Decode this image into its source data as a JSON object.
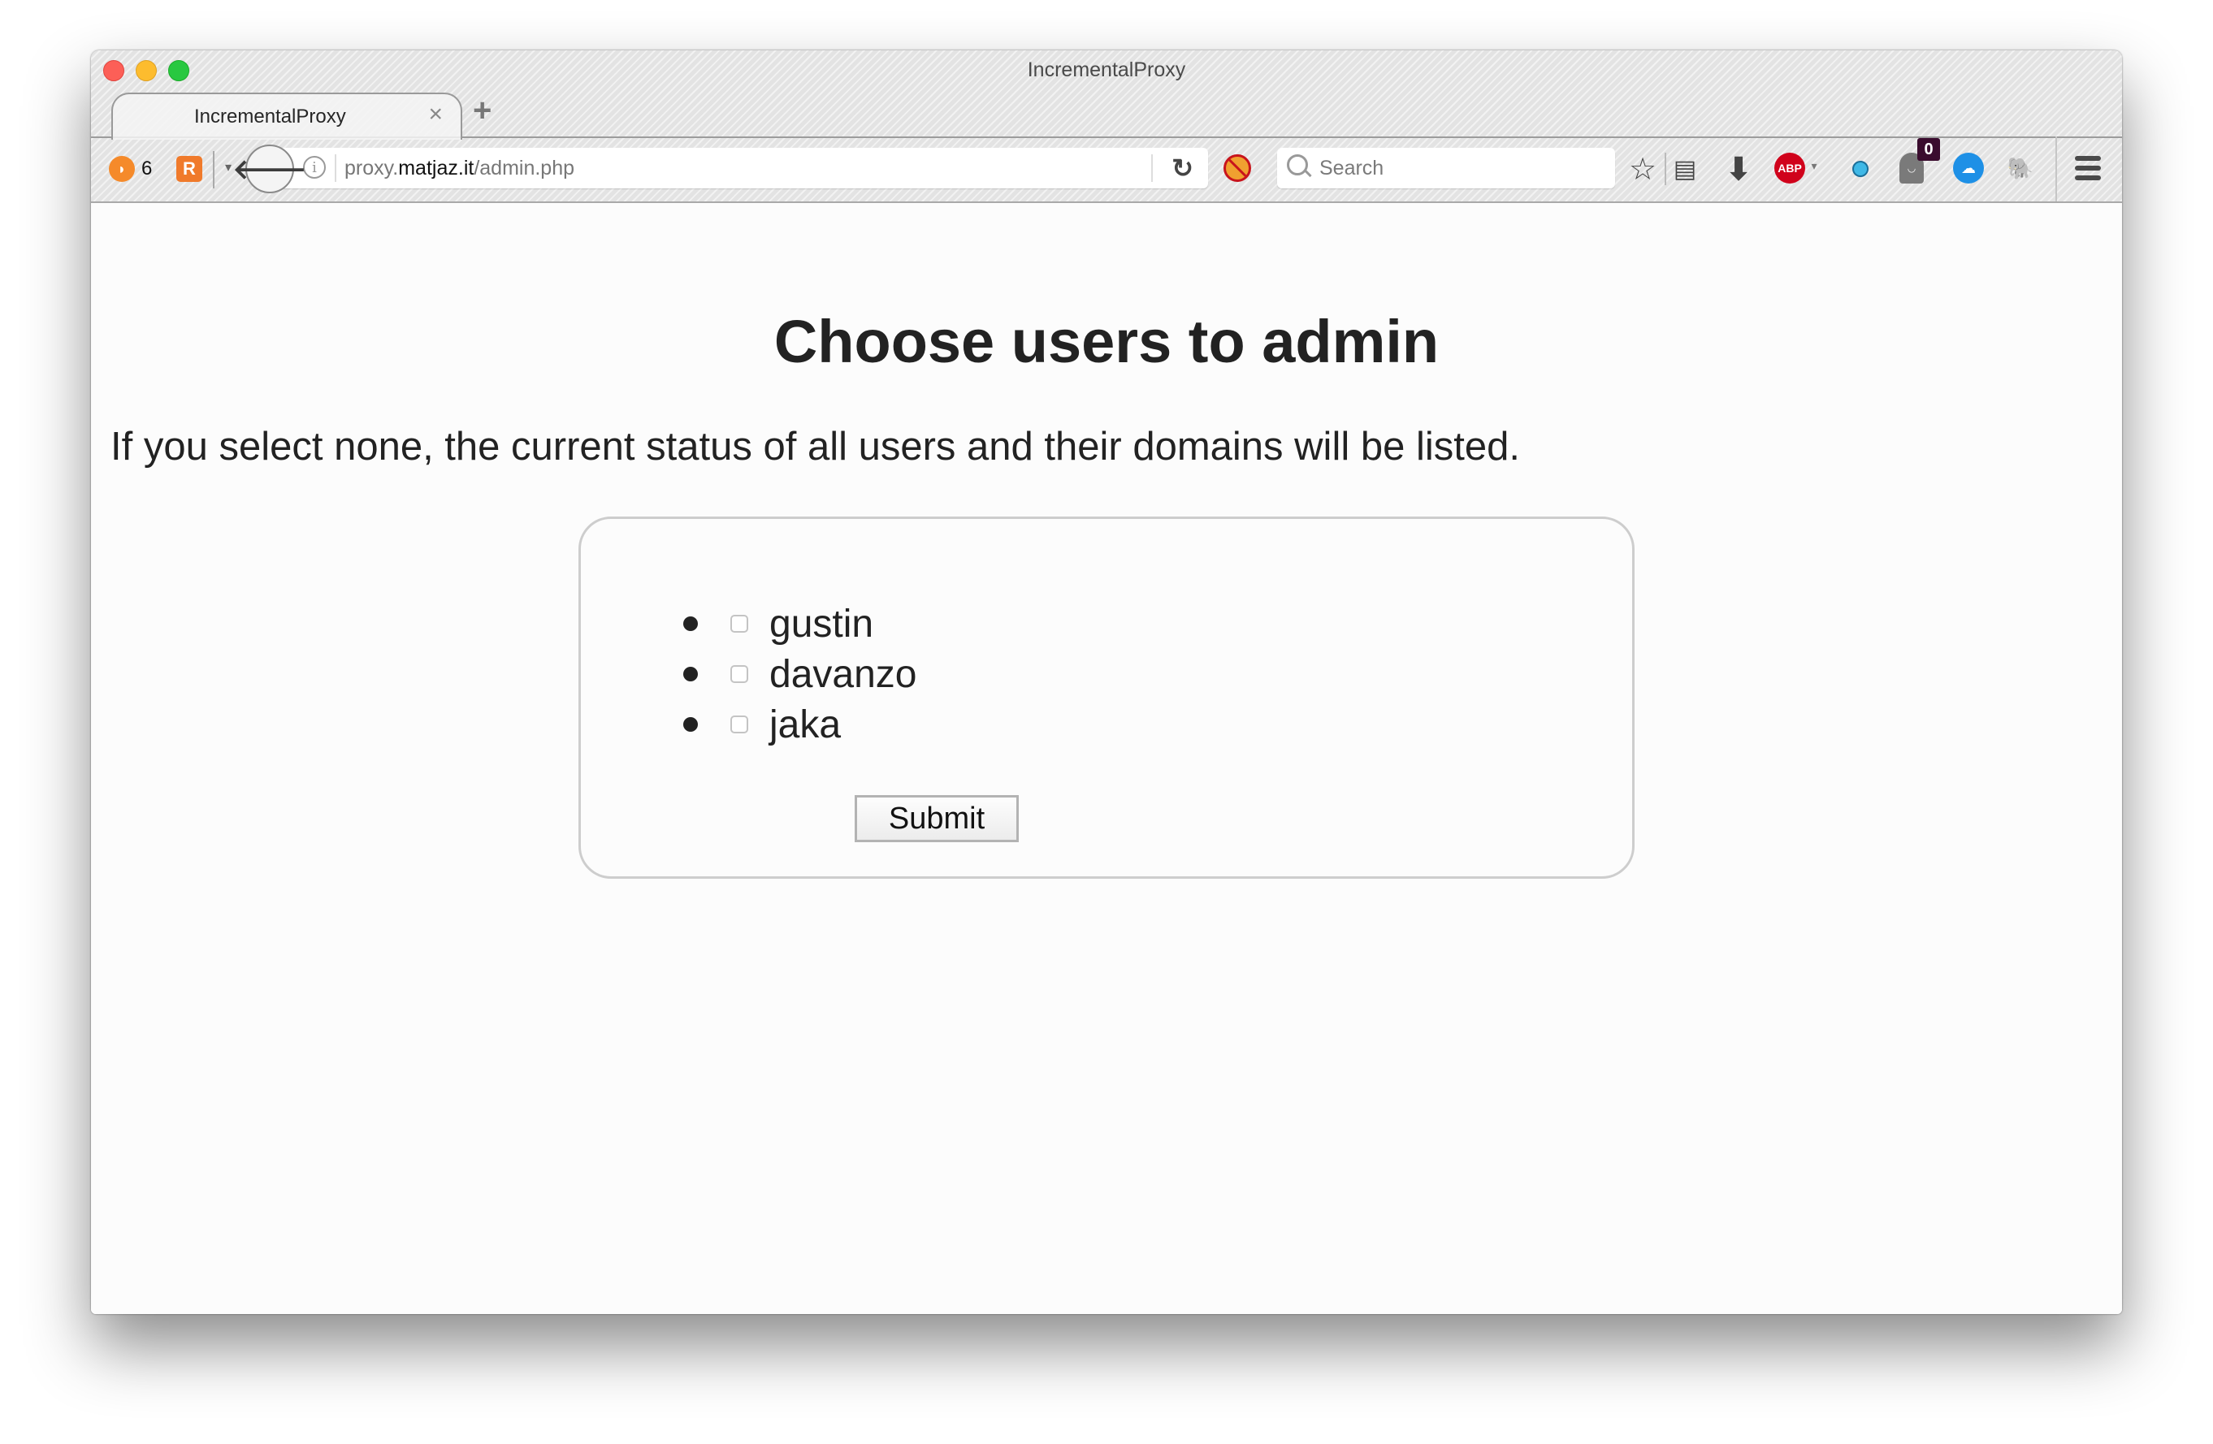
{
  "window": {
    "title": "IncrementalProxy"
  },
  "tabs": [
    {
      "label": "IncrementalProxy",
      "active": true
    }
  ],
  "tabstrip": {
    "close_glyph": "×",
    "new_tab_glyph": "+"
  },
  "toolbar": {
    "rss_count": "6",
    "rss_glyph": "◗",
    "r_glyph": "R",
    "dropdown_glyph": "▾",
    "back_glyph": "🡐",
    "url": {
      "prefix": "proxy.",
      "host": "matjaz.it",
      "path": "/admin.php"
    },
    "info_glyph": "i",
    "reload_glyph": "↻",
    "search_placeholder": "Search",
    "star_glyph": "☆",
    "reading_glyph": "▤",
    "download_glyph": "⬇",
    "abp_label": "ABP",
    "abp_arrow": "▾",
    "ghostery_badge": "0",
    "ghostery_face": "◡",
    "cloud_glyph": "☁",
    "evernote_glyph": "🐘"
  },
  "page": {
    "heading": "Choose users to admin",
    "description": "If you select none, the current status of all users and their domains will be listed.",
    "users": [
      {
        "name": "gustin",
        "checked": false
      },
      {
        "name": "davanzo",
        "checked": false
      },
      {
        "name": "jaka",
        "checked": false
      }
    ],
    "submit_label": "Submit"
  },
  "colors": {
    "traffic_close": "#fc5f57",
    "traffic_min": "#fdbc2e",
    "traffic_max": "#28c840",
    "abp_red": "#d0021b",
    "ghostery_badge_bg": "#3a0c2e",
    "form_border": "#cdcdcd"
  }
}
